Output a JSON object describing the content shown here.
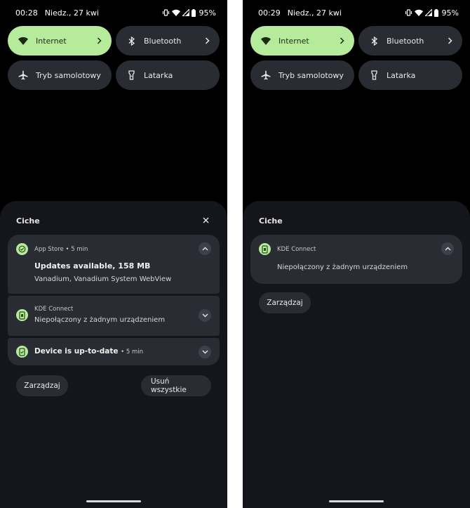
{
  "left": {
    "status": {
      "time": "00:28",
      "date": "Niedz., 27 kwi",
      "battery": "95%"
    },
    "tiles": [
      {
        "label": "Internet",
        "icon": "wifi-icon",
        "active": true
      },
      {
        "label": "Bluetooth",
        "icon": "bluetooth-icon",
        "active": false
      },
      {
        "label": "Tryb samolotowy",
        "icon": "airplane-icon",
        "active": false
      },
      {
        "label": "Latarka",
        "icon": "flashlight-icon",
        "active": false
      }
    ],
    "section_title": "Ciche",
    "notifications": [
      {
        "app": "App Store",
        "time": "5 min",
        "title": "Updates available, 158 MB",
        "text": "Vanadium, Vanadium System WebView",
        "expanded": true
      },
      {
        "app": "KDE Connect",
        "text": "Niepołączony z żadnym urządzeniem",
        "expanded": false
      },
      {
        "title": "Device is up-to-date",
        "time": "5 min",
        "expanded": false
      }
    ],
    "manage_label": "Zarządzaj",
    "clear_all_label": "Usuń wszystkie"
  },
  "right": {
    "status": {
      "time": "00:29",
      "date": "Niedz., 27 kwi",
      "battery": "95%"
    },
    "tiles": [
      {
        "label": "Internet",
        "icon": "wifi-icon",
        "active": true
      },
      {
        "label": "Bluetooth",
        "icon": "bluetooth-icon",
        "active": false
      },
      {
        "label": "Tryb samolotowy",
        "icon": "airplane-icon",
        "active": false
      },
      {
        "label": "Latarka",
        "icon": "flashlight-icon",
        "active": false
      }
    ],
    "section_title": "Ciche",
    "notifications": [
      {
        "app": "KDE Connect",
        "text": "Niepołączony z żadnym urządzeniem",
        "expanded": true
      }
    ],
    "manage_label": "Zarządzaj"
  },
  "colors": {
    "accent": "#b7eb9c",
    "tile": "#2a2c33",
    "panel": "#15161b",
    "background": "#000000"
  }
}
